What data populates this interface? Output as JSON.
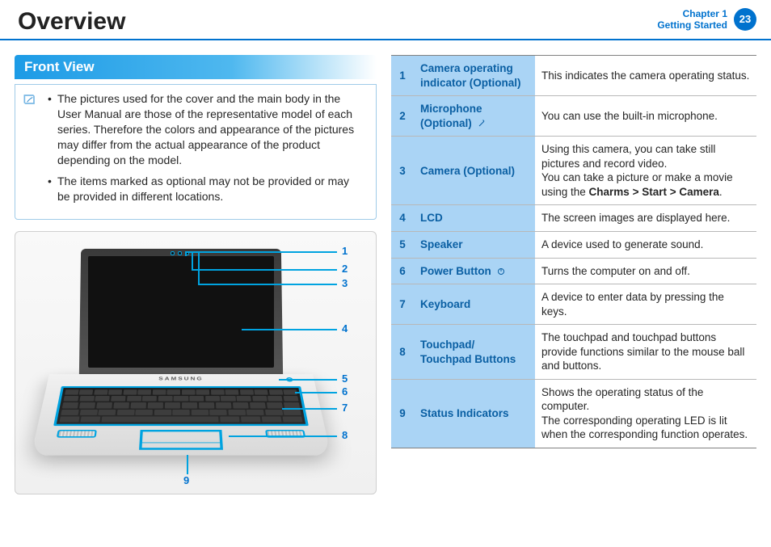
{
  "header": {
    "title": "Overview",
    "chapter_line1": "Chapter 1",
    "chapter_line2": "Getting Started",
    "page_number": "23"
  },
  "section": {
    "title": "Front View"
  },
  "notes": [
    "The pictures used for the cover and the main body in the User Manual are those of the representative model of each series. Therefore the colors and appearance of the pictures may differ from the actual appearance of the product depending on the model.",
    "The items marked as optional may not be provided or may be provided in different locations."
  ],
  "diagram": {
    "brand_label": "SAMSUNG",
    "callouts": [
      "1",
      "2",
      "3",
      "4",
      "5",
      "6",
      "7",
      "8",
      "9"
    ]
  },
  "parts": [
    {
      "num": "1",
      "name": "Camera operating indicator (Optional)",
      "desc_html": "This indicates the camera operating status."
    },
    {
      "num": "2",
      "name": "Microphone (Optional)",
      "icon": "mic",
      "desc_html": "You can use the built-in microphone."
    },
    {
      "num": "3",
      "name": "Camera (Optional)",
      "desc_html": "Using this camera, you can take still pictures and record video.<br>You can take a picture or make a movie using the <span class=\"bold\">Charms &gt; Start &gt; Camera</span>."
    },
    {
      "num": "4",
      "name": "LCD",
      "desc_html": "The screen images are displayed here."
    },
    {
      "num": "5",
      "name": "Speaker",
      "desc_html": "A device used to generate sound."
    },
    {
      "num": "6",
      "name": "Power Button",
      "icon": "power",
      "desc_html": "Turns the computer on and off."
    },
    {
      "num": "7",
      "name": "Keyboard",
      "desc_html": "A device to enter data by pressing the keys."
    },
    {
      "num": "8",
      "name": "Touchpad/ Touchpad Buttons",
      "desc_html": "The touchpad and touchpad buttons provide functions similar to the mouse ball and buttons."
    },
    {
      "num": "9",
      "name": "Status Indicators",
      "desc_html": "Shows the operating status of the computer.<br>The corresponding operating LED is lit when the corresponding function operates."
    }
  ]
}
